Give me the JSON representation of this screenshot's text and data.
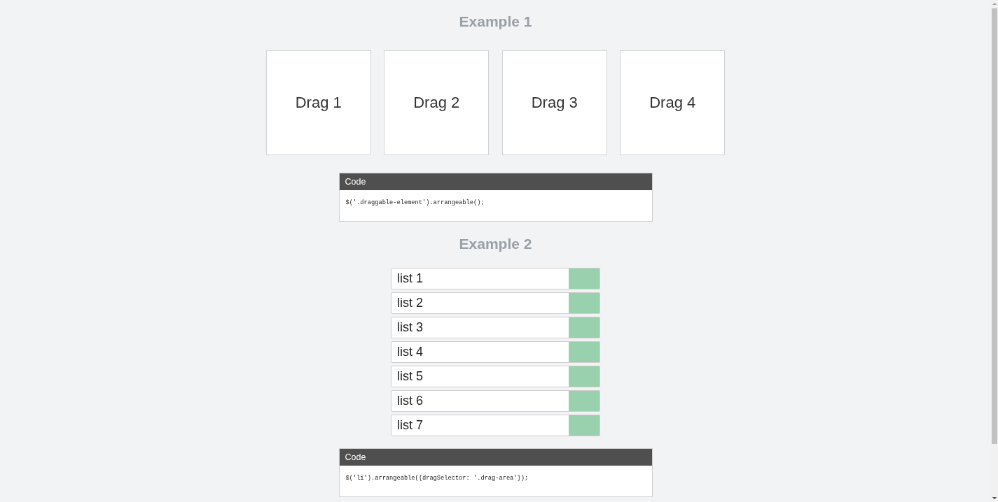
{
  "examples": [
    {
      "title": "Example 1",
      "kind": "tiles",
      "items": [
        {
          "label": "Drag 1"
        },
        {
          "label": "Drag 2"
        },
        {
          "label": "Drag 3"
        },
        {
          "label": "Drag 4"
        }
      ],
      "code": {
        "header": "Code",
        "text": "$('.draggable-element').arrangeable();"
      }
    },
    {
      "title": "Example 2",
      "kind": "list",
      "items": [
        {
          "label": "list 1"
        },
        {
          "label": "list 2"
        },
        {
          "label": "list 3"
        },
        {
          "label": "list 4"
        },
        {
          "label": "list 5"
        },
        {
          "label": "list 6"
        },
        {
          "label": "list 7"
        }
      ],
      "code": {
        "header": "Code",
        "text": "$('li').arrangeable({dragSelector: '.drag-area'});"
      }
    }
  ]
}
